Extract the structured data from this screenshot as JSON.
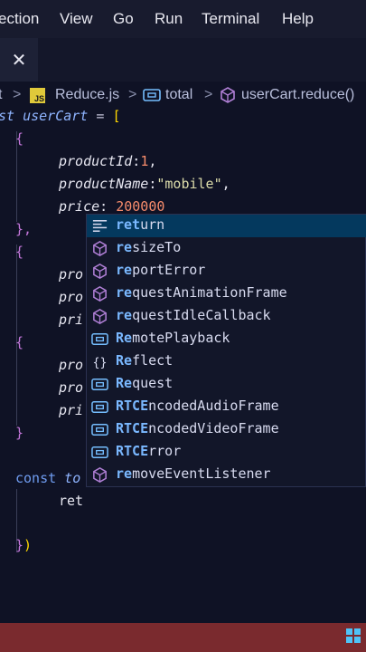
{
  "menubar": {
    "items": [
      "ection",
      "View",
      "Go",
      "Run",
      "Terminal",
      "Help"
    ]
  },
  "tab": {
    "close_glyph": "✕"
  },
  "breadcrumb": {
    "part0": "t",
    "sep": ">",
    "file_badge": "JS",
    "file": "Reduce.js",
    "var": "total",
    "method": "userCart.reduce()"
  },
  "code": {
    "l1_kw": "st",
    "l1_var": "userCart",
    "l1_op": " = ",
    "l1_br": "[",
    "l2": "{",
    "l3_prop": "productId",
    "l3_colon": ":",
    "l3_num": "1",
    "l3_comma": ",",
    "l4_prop": "productName",
    "l4_colon": ":",
    "l4_str": "\"mobile\"",
    "l4_comma": ",",
    "l5_prop": "price",
    "l5_colon": ": ",
    "l5_num": "200000",
    "l6": "},",
    "l7": "{",
    "l8": "pro",
    "l9": "pro",
    "l10": "pri",
    "l11": "{",
    "l12": "pro",
    "l13": "pro",
    "l14": "pri",
    "l15": "}",
    "l17_kw": "const",
    "l17_var": " to",
    "l18": "ret",
    "l21_a": "}",
    "l21_b": ")"
  },
  "suggestions": [
    {
      "match": "ret",
      "rest": "urn",
      "icon": "snippet-icon",
      "selected": true
    },
    {
      "match": "re",
      "rest": "sizeTo",
      "icon": "method-icon",
      "selected": false
    },
    {
      "match": "re",
      "rest": "portError",
      "icon": "method-icon",
      "selected": false
    },
    {
      "match": "re",
      "rest": "questAnimationFrame",
      "icon": "method-icon",
      "selected": false
    },
    {
      "match": "re",
      "rest": "questIdleCallback",
      "icon": "method-icon",
      "selected": false
    },
    {
      "match": "Re",
      "rest": "motePlayback",
      "icon": "variable-icon",
      "selected": false
    },
    {
      "match": "Re",
      "rest": "flect",
      "icon": "module-icon",
      "selected": false
    },
    {
      "match": "Re",
      "rest": "quest",
      "icon": "variable-icon",
      "selected": false
    },
    {
      "match": "RTCE",
      "rest": "ncodedAudioFrame",
      "icon": "variable-icon",
      "selected": false
    },
    {
      "match": "RTCE",
      "rest": "ncodedVideoFrame",
      "icon": "variable-icon",
      "selected": false
    },
    {
      "match": "RTCE",
      "rest": "rror",
      "icon": "variable-icon",
      "selected": false
    },
    {
      "match": "re",
      "rest": "moveEventListener",
      "icon": "method-icon",
      "selected": false
    }
  ],
  "colors": {
    "accent": "#7ab8ff",
    "selection": "#04395e",
    "status": "#7a2a2e",
    "method_icon": "#b180d7",
    "variable_icon": "#75beff"
  }
}
